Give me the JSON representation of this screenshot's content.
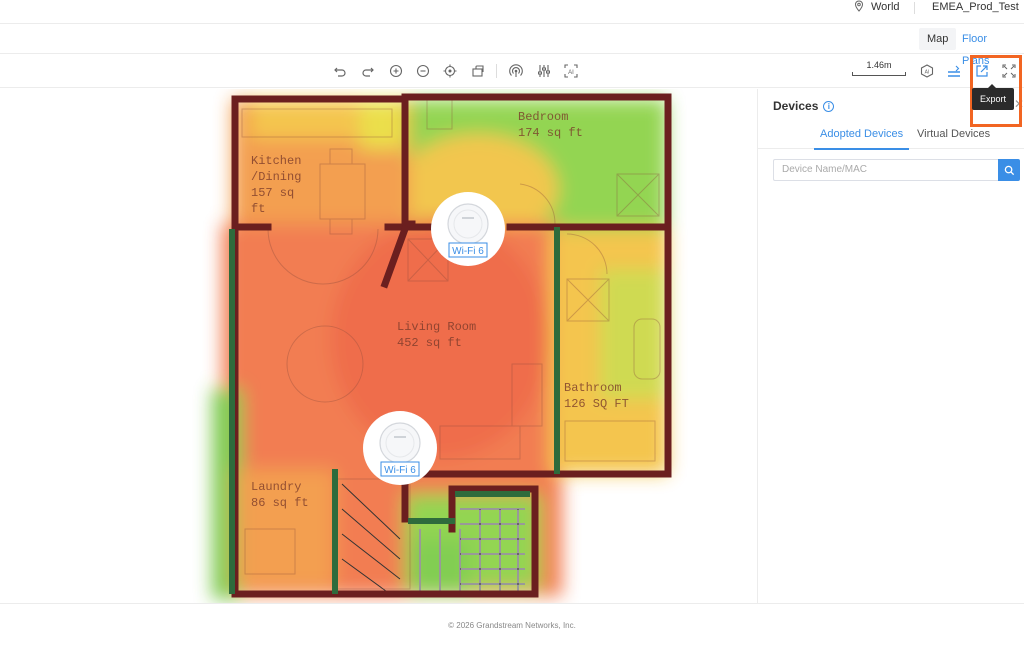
{
  "topbar": {
    "site_label": "World",
    "org_label": "EMEA_Prod_Test"
  },
  "tabs": {
    "map": "Map",
    "floor_plans": "Floor Plans"
  },
  "toolbar": {
    "scale_label": "1.46m",
    "export_tooltip": "Export",
    "icons": [
      "undo-icon",
      "redo-icon",
      "zoom-in-icon",
      "zoom-out-icon",
      "locate-icon",
      "rotate-icon",
      "signal-icon",
      "adjust-icon",
      "ai-icon",
      "ai-layout-icon",
      "wall-icon",
      "export-icon",
      "fullscreen-icon"
    ]
  },
  "floorplan": {
    "rooms": [
      {
        "name": "Bedroom",
        "area": "174 sq ft"
      },
      {
        "name": "Kitchen\n/Dining",
        "area": "157 sq\nft"
      },
      {
        "name": "Living Room",
        "area": "452 sq ft"
      },
      {
        "name": "Bathroom",
        "area": "126 SQ FT"
      },
      {
        "name": "Laundry",
        "area": "86 sq ft"
      }
    ],
    "access_points": [
      {
        "label": "Wi-Fi 6"
      },
      {
        "label": "Wi-Fi 6"
      }
    ]
  },
  "devices_panel": {
    "title": "Devices",
    "tabs": [
      "Adopted Devices",
      "Virtual Devices"
    ],
    "search_placeholder": "Device Name/MAC"
  },
  "footer": {
    "copyright": "© 2026 Grandstream Networks, Inc."
  },
  "colors": {
    "accent": "#3a8ee6",
    "highlight": "#f26522",
    "wall": "#6b1f1f",
    "wall_green": "#2e6b3c"
  }
}
